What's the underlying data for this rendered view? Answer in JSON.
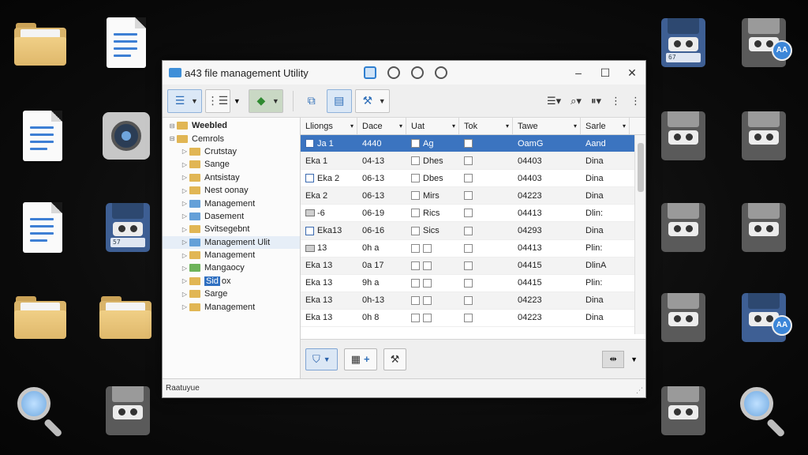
{
  "window": {
    "title": "a43 file management Utility",
    "controls": {
      "minimize": "–",
      "maximize": "☐",
      "close": "✕"
    }
  },
  "tree": [
    {
      "label": "Weebled",
      "level": 0,
      "icon": "folder-icon",
      "bold": true
    },
    {
      "label": "Cemrols",
      "level": 0,
      "icon": "folder-icon"
    },
    {
      "label": "Crutstay",
      "level": 1,
      "icon": "folder-icon"
    },
    {
      "label": "Sange",
      "level": 1,
      "icon": "folder-icon"
    },
    {
      "label": "Antsistay",
      "level": 1,
      "icon": "folder-icon"
    },
    {
      "label": "Nest oonay",
      "level": 1,
      "icon": "folder-icon"
    },
    {
      "label": "Management",
      "level": 1,
      "icon": "folder-icon-blue"
    },
    {
      "label": "Dasement",
      "level": 1,
      "icon": "folder-icon-blue"
    },
    {
      "label": "Svitsegebnt",
      "level": 1,
      "icon": "folder-icon"
    },
    {
      "label": "Management Ulit",
      "level": 1,
      "icon": "folder-icon-blue",
      "highlight": true
    },
    {
      "label": "Management",
      "level": 1,
      "icon": "folder-icon"
    },
    {
      "label": "Mangaocy",
      "level": 1,
      "icon": "folder-icon-green"
    },
    {
      "label": "Sid",
      "suffix": "ox",
      "level": 1,
      "icon": "folder-icon",
      "selected": true
    },
    {
      "label": "Sarge",
      "level": 1,
      "icon": "folder-icon"
    },
    {
      "label": "Management",
      "level": 1,
      "icon": "folder-icon"
    }
  ],
  "columns": [
    "Lliongs",
    "Dace",
    "Uat",
    "Tok",
    "Tawe",
    "Sarle"
  ],
  "rows": [
    {
      "name": "Ja 1",
      "date": "4440",
      "uat": "Ag",
      "size": "OamG",
      "state": "Aand",
      "selected": true
    },
    {
      "name": "Eka 1",
      "date": "04-13",
      "uat": "Dhes",
      "size": "04403",
      "state": "Dina"
    },
    {
      "name": "Eka 2",
      "date": "06-13",
      "uat": "Dbes",
      "size": "04403",
      "state": "Dina",
      "checked_name": true
    },
    {
      "name": "Eka 2",
      "date": "06-13",
      "uat": "Mirs",
      "size": "04223",
      "state": "Dina"
    },
    {
      "name": "-6",
      "date": "06-19",
      "uat": "Rics",
      "size": "04413",
      "state": "Dlin:"
    },
    {
      "name": "Eka13",
      "date": "06-16",
      "uat": "Sics",
      "size": "04293",
      "state": "Dina",
      "checked_name": true
    },
    {
      "name": "13",
      "date": "0h a",
      "uat": "",
      "size": "04413",
      "state": "Plin:"
    },
    {
      "name": "Eka 13",
      "date": "0a 17",
      "uat": "",
      "size": "04415",
      "state": "DlinA"
    },
    {
      "name": "Eka 13",
      "date": "9h a",
      "uat": "",
      "size": "04415",
      "state": "Plin:"
    },
    {
      "name": "Eka 13",
      "date": "0h-13",
      "uat": "",
      "size": "04223",
      "state": "Dina"
    },
    {
      "name": "Eka 13",
      "date": "0h 8",
      "uat": "",
      "size": "04223",
      "state": "Dina"
    }
  ],
  "bottom": {
    "right_box": "⇹"
  },
  "status": "Raatuyue",
  "desktop": {
    "floppy_label_1": "67",
    "floppy_label_2": "57",
    "badge": "AA"
  }
}
